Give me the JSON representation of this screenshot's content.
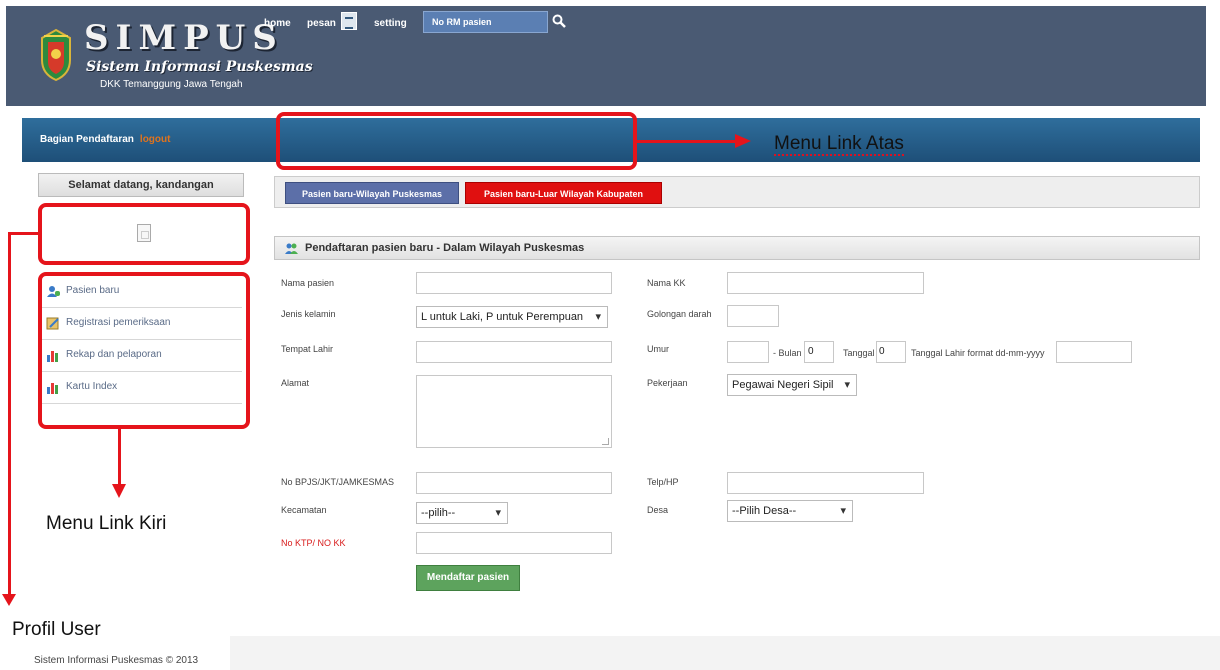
{
  "header": {
    "title": "SIMPUS",
    "subtitle": "Sistem Informasi Puskesmas",
    "org": "DKK Temanggung Jawa Tengah"
  },
  "navbar": {
    "section": "Bagian Pendaftaran",
    "logout": "logout",
    "home": "home",
    "pesan": "pesan",
    "setting": "setting",
    "search_placeholder": "No RM pasien"
  },
  "sidebar": {
    "welcome": "Selamat datang, kandangan",
    "items": [
      {
        "label": "Pasien baru",
        "icon": "user-add-icon"
      },
      {
        "label": "Registrasi pemeriksaan",
        "icon": "edit-icon"
      },
      {
        "label": "Rekap dan pelaporan",
        "icon": "bar-chart-icon"
      },
      {
        "label": "Kartu Index",
        "icon": "bar-chart-icon"
      }
    ]
  },
  "tabs": [
    {
      "label": "Pasien baru-Wilayah Puskesmas"
    },
    {
      "label": "Pasien baru-Luar Wilayah Kabupaten"
    }
  ],
  "form": {
    "heading": "Pendaftaran pasien baru - Dalam Wilayah Puskesmas",
    "labels": {
      "nama_pasien": "Nama pasien",
      "jenis_kelamin": "Jenis kelamin",
      "tempat_lahir": "Tempat Lahir",
      "alamat": "Alamat",
      "no_bpjs": "No BPJS/JKT/JAMKESMAS",
      "kecamatan": "Kecamatan",
      "no_ktp": "No KTP/ NO KK",
      "nama_kk": "Nama KK",
      "golongan_darah": "Golongan darah",
      "umur": "Umur",
      "bulan": "- Bulan",
      "tanggal": "Tanggal",
      "tanggal_lahir": "Tanggal Lahir format dd-mm-yyyy",
      "pekerjaan": "Pekerjaan",
      "telp": "Telp/HP",
      "desa": "Desa"
    },
    "values": {
      "jenis_kelamin": "L untuk Laki, P untuk Perempuan",
      "bulan": "0",
      "tanggal": "0",
      "pekerjaan": "Pegawai Negeri Sipil",
      "kecamatan": "--pilih--",
      "desa": "--Pilih Desa--"
    },
    "submit": "Mendaftar pasien"
  },
  "annotations": {
    "menu_atas": "Menu Link Atas",
    "menu_kiri": "Menu Link Kiri",
    "profil_user": "Profil User"
  },
  "footer": "Sistem Informasi Puskesmas © 2013",
  "colors": {
    "header": "#4a5a73",
    "nav": "#2a6391",
    "highlight": "#e5141b",
    "tab_active": "#e01010",
    "tab_inactive": "#5c6fa8",
    "submit": "#5da35d"
  }
}
